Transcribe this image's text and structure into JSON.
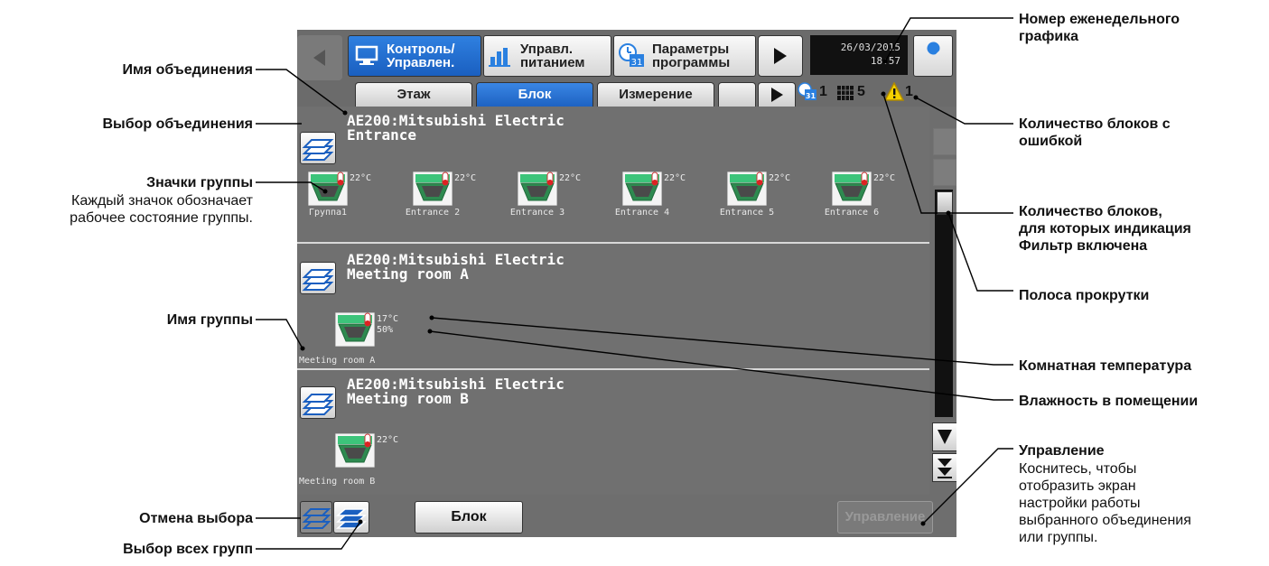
{
  "header": {
    "tabs": [
      {
        "label": "Контроль/\nУправлен.",
        "active": true,
        "icon": "monitor-icon"
      },
      {
        "label": "Управл.\nпитанием",
        "active": false,
        "icon": "bar-chart-icon"
      },
      {
        "label": "Параметры\nпрограммы",
        "active": false,
        "icon": "calendar-icon"
      }
    ],
    "date": "26/03/2015",
    "time": "18:57"
  },
  "subtabs": [
    {
      "label": "Этаж",
      "active": false
    },
    {
      "label": "Блок",
      "active": true
    },
    {
      "label": "Измерение",
      "active": false
    },
    {
      "label": "",
      "active": false
    }
  ],
  "status": {
    "weekly_schedule_number": "1",
    "filter_count": "5",
    "error_count": "1"
  },
  "blocks": [
    {
      "name_line1": "AE200:Mitsubishi Electric",
      "name_line2": "Entrance",
      "groups": [
        {
          "label": "Группа1",
          "temp": "22°C"
        },
        {
          "label": "Entrance 2",
          "temp": "22°C"
        },
        {
          "label": "Entrance 3",
          "temp": "22°C"
        },
        {
          "label": "Entrance 4",
          "temp": "22°C"
        },
        {
          "label": "Entrance 5",
          "temp": "22°C"
        },
        {
          "label": "Entrance 6",
          "temp": "22°C"
        }
      ]
    },
    {
      "name_line1": "AE200:Mitsubishi Electric",
      "name_line2": "Meeting room A",
      "groups": [
        {
          "label": "Meeting room A",
          "temp": "17°C",
          "humidity": "50%"
        }
      ]
    },
    {
      "name_line1": "AE200:Mitsubishi Electric",
      "name_line2": "Meeting room B",
      "groups": [
        {
          "label": "Meeting room B",
          "temp": "22°C"
        }
      ]
    }
  ],
  "footer": {
    "block_button": "Блок",
    "control_button": "Управление"
  },
  "annotations": {
    "weekly_schedule": "Номер еженедельного\nграфика",
    "block_name": "Имя объединения",
    "block_select": "Выбор объединения",
    "group_icons": "Значки группы",
    "group_icons_desc": "Каждый значок обозначает\nрабочее состояние группы.",
    "error_count": "Количество блоков с\nошибкой",
    "filter_count": "Количество блоков,\nдля которых индикация\nФильтр включена",
    "scrollbar": "Полоса прокрутки",
    "group_name": "Имя группы",
    "room_temp": "Комнатная температура",
    "room_humidity": "Влажность в помещении",
    "control": "Управление",
    "control_desc": "Коснитесь, чтобы\nотобразить экран\nнастройки работы\nвыбранного объединения\nили группы.",
    "cancel_select": "Отмена выбора",
    "select_all": "Выбор всех групп"
  },
  "colors": {
    "screen_bg": "#707070",
    "active_tab": "#1d62c2",
    "warning": "#f5d000"
  }
}
